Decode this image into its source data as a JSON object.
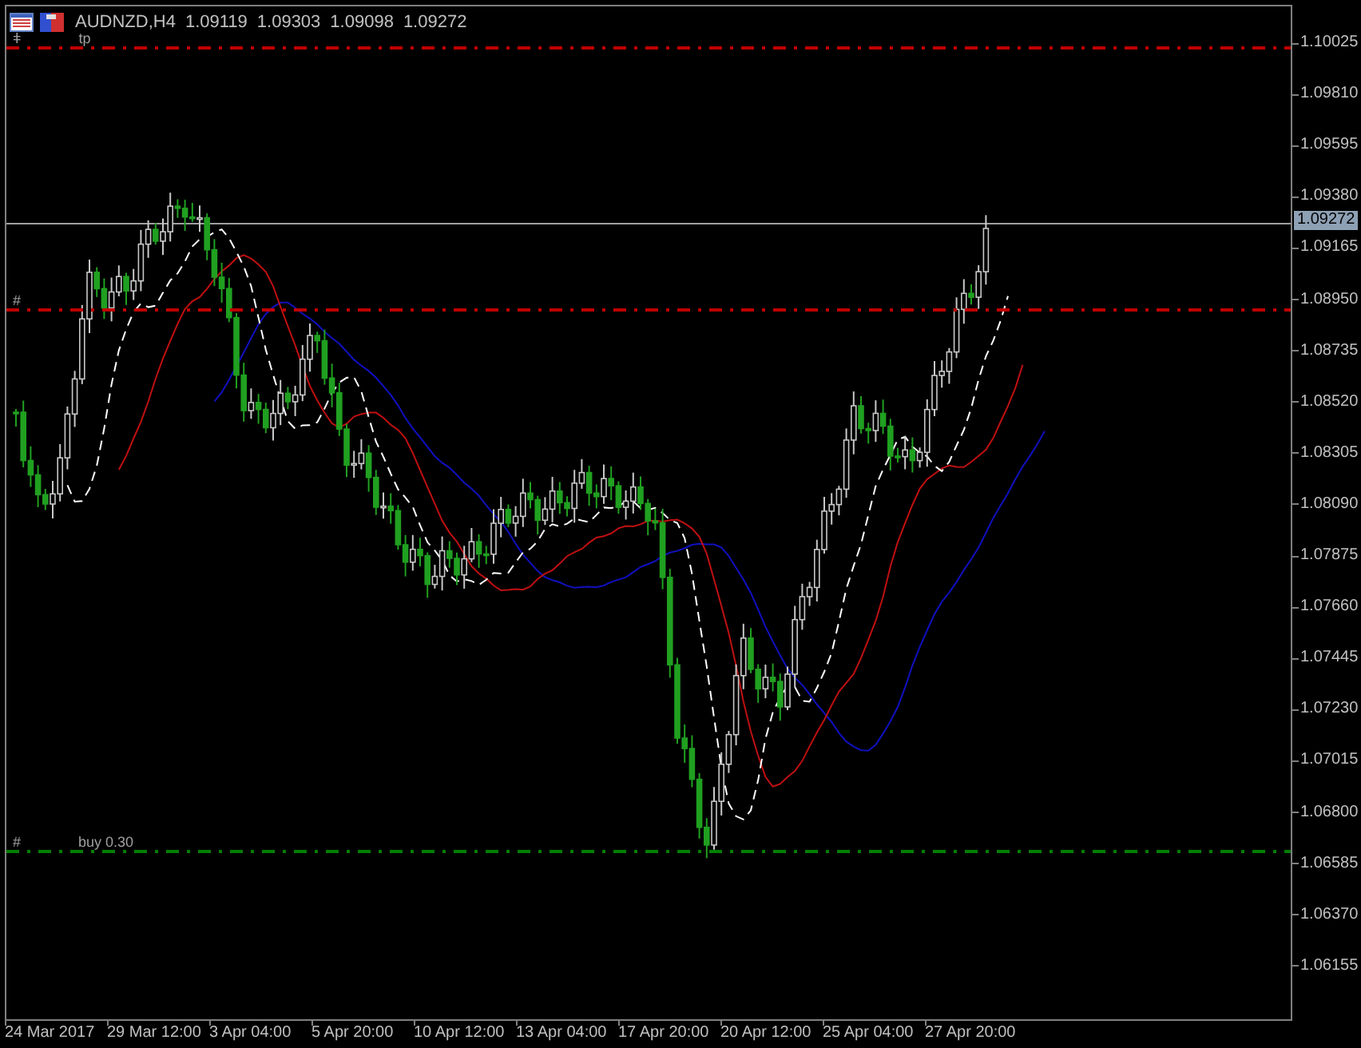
{
  "header": {
    "symbol": "AUDNZD,H4",
    "ohlc": [
      "1.09119",
      "1.09303",
      "1.09098",
      "1.09272"
    ]
  },
  "levels": [
    {
      "marker": "ǂ",
      "label": "tp",
      "color": "#c00000"
    },
    {
      "marker": "#",
      "color": "#c00000"
    },
    {
      "marker": "#",
      "label": "buy 0.30",
      "color": "#008000"
    }
  ],
  "price_axis": {
    "labels": [
      "1.10025",
      "1.09810",
      "1.09595",
      "1.09380",
      "1.09165",
      "1.08950",
      "1.08735",
      "1.08520",
      "1.08305",
      "1.08090",
      "1.07875",
      "1.07660",
      "1.07445",
      "1.07230",
      "1.07015",
      "1.06800",
      "1.06585",
      "1.06370",
      "1.06155"
    ],
    "current_price": "1.09272"
  },
  "time_axis": {
    "labels": [
      "24 Mar 2017",
      "29 Mar 12:00",
      "3 Apr 04:00",
      "5 Apr 20:00",
      "10 Apr 12:00",
      "13 Apr 04:00",
      "17 Apr 20:00",
      "20 Apr 12:00",
      "25 Apr 04:00",
      "27 Apr 20:00"
    ]
  }
}
